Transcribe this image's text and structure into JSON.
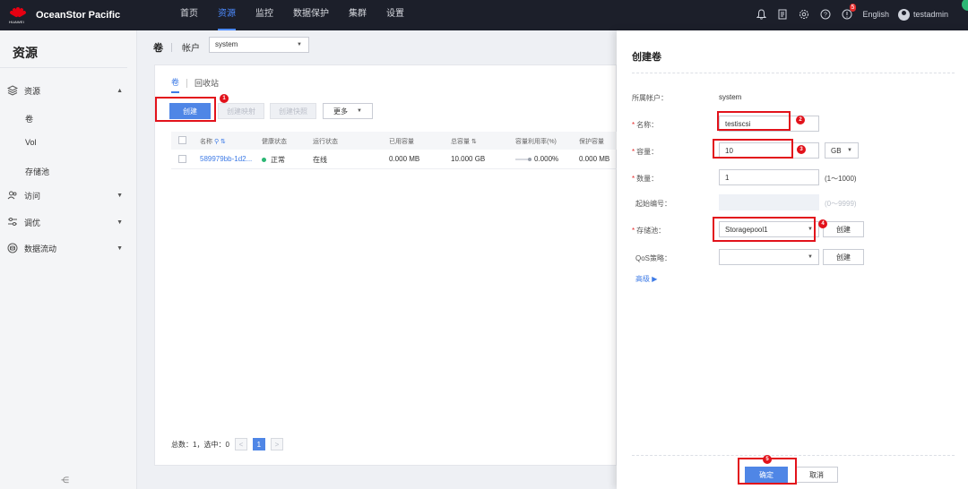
{
  "app": {
    "brand_small": "HUAWEI",
    "product": "OceanStor Pacific",
    "nav": [
      "首页",
      "资源",
      "监控",
      "数据保护",
      "集群",
      "设置"
    ],
    "active_nav": "资源",
    "notify_count": "5",
    "language": "English",
    "username": "testadmin"
  },
  "sidebar": {
    "title": "资源",
    "groups": [
      {
        "label": "资源",
        "icon": "layers-icon",
        "expanded": true,
        "children": [
          "卷",
          "Vol",
          "存储池"
        ]
      },
      {
        "label": "访问",
        "icon": "access-icon",
        "expanded": false
      },
      {
        "label": "调优",
        "icon": "tuning-icon",
        "expanded": false
      },
      {
        "label": "数据流动",
        "icon": "dataflow-icon",
        "expanded": false
      }
    ],
    "collapse_glyph": "⋲"
  },
  "main": {
    "title": "卷",
    "account_label": "帐户",
    "account_value": "system",
    "tabs": [
      "卷",
      "回收站"
    ],
    "active_tab": "卷",
    "buttons": {
      "create": "创建",
      "create_map": "创建映射",
      "create_snapshot": "创建快照",
      "more": "更多"
    },
    "table": {
      "columns": [
        "名称",
        "健康状态",
        "运行状态",
        "已用容量",
        "总容量",
        "容量利用率(%)",
        "保护容量"
      ],
      "rows": [
        {
          "name": "589979bb-1d2...",
          "health": "正常",
          "running": "在线",
          "used": "0.000 MB",
          "total": "10.000 GB",
          "util": "0.000%",
          "protect": "0.000 MB"
        }
      ]
    },
    "pager": {
      "summary": "总数：1，选中：0",
      "prev": "<",
      "current": "1",
      "next": ">"
    }
  },
  "drawer": {
    "title": "创建卷",
    "fields": {
      "account": {
        "label": "所属帐户：",
        "value": "system"
      },
      "name": {
        "label": "名称：",
        "value": "testiscsi"
      },
      "capacity": {
        "label": "容量：",
        "value": "10",
        "unit": "GB"
      },
      "count": {
        "label": "数量：",
        "value": "1",
        "hint": "(1～1000)"
      },
      "start_no": {
        "label": "起始编号：",
        "value": "",
        "hint": "(0～9999)"
      },
      "pool": {
        "label": "存储池：",
        "value": "Storagepool1",
        "create": "创建"
      },
      "qos": {
        "label": "QoS策略：",
        "value": "",
        "create": "创建"
      }
    },
    "advanced": "高级 ▶",
    "ok": "确定",
    "cancel": "取消"
  },
  "annotations": [
    "1",
    "2",
    "3",
    "4",
    "5"
  ],
  "colors": {
    "accent": "#4f86e6",
    "topbar": "#1c1f2a",
    "annotation": "#e2121b",
    "healthy": "#2bb673"
  }
}
